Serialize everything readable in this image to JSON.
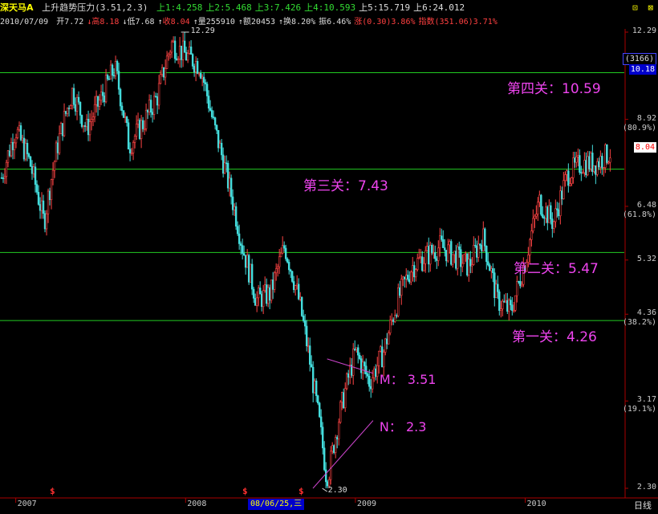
{
  "header": {
    "stock_name": "深天马A",
    "indicator": "上升趋势压力(3.51,2.3)",
    "levels": [
      {
        "label": "上1:",
        "value": "4.258",
        "color": "green"
      },
      {
        "label": "上2:",
        "value": "5.468",
        "color": "green"
      },
      {
        "label": "上3:",
        "value": "7.426",
        "color": "green"
      },
      {
        "label": "上4:",
        "value": "10.593",
        "color": "green"
      },
      {
        "label": "上5:",
        "value": "15.719",
        "color": "white"
      },
      {
        "label": "上6:",
        "value": "24.012",
        "color": "white"
      }
    ],
    "window_buttons": [
      "⊡",
      "⊠"
    ]
  },
  "quote": {
    "date": "2010/07/09",
    "open_label": "开",
    "open": "7.72",
    "high_label": "高",
    "high": "8.18",
    "low_label": "低",
    "low": "7.68",
    "close_label": "收",
    "close": "8.04",
    "volume_label": "量",
    "volume": "255910",
    "amount_label": "额",
    "amount": "20453",
    "turnover_label": "换",
    "turnover": "8.20%",
    "amplitude_label": "振",
    "amplitude": "6.46%",
    "change_label": "涨",
    "change": "(0.30)3.86%",
    "index_label": "指数",
    "index": "(351.06)3.71%"
  },
  "axis": {
    "y_ticks": [
      {
        "value": 12.29,
        "text": "12.29"
      },
      {
        "value": 8.92,
        "text": "8.92"
      },
      {
        "value": 6.48,
        "text": "6.48"
      },
      {
        "value": 5.32,
        "text": "5.32"
      },
      {
        "value": 4.36,
        "text": "4.36"
      },
      {
        "value": 3.17,
        "text": "3.17"
      },
      {
        "value": 2.3,
        "text": "2.30"
      }
    ],
    "y_pcts": [
      {
        "value": 8.92,
        "text": "(80.9%)"
      },
      {
        "value": 6.48,
        "text": "(61.8%)"
      },
      {
        "value": 4.36,
        "text": "(38.2%)"
      },
      {
        "value": 3.17,
        "text": "(19.1%)"
      }
    ],
    "marker_top": {
      "value": 10.6,
      "text1": "(3166)",
      "text2": "10.18"
    },
    "marker_current": {
      "value": 8.04,
      "text": "8.04"
    },
    "date_labels": [
      {
        "text": "2007",
        "x_date": "2007-01"
      },
      {
        "text": "2008",
        "x_date": "2008-01"
      },
      {
        "text": "2009",
        "x_date": "2009-01"
      },
      {
        "text": "2010",
        "x_date": "2010-01"
      }
    ],
    "date_cursor": "08/06/25,三",
    "period": "日线"
  },
  "levels_drawn": [
    {
      "label": "第四关：10.59",
      "value": 10.59
    },
    {
      "label": "第三关：7.43",
      "value": 7.43
    },
    {
      "label": "第二关：5.47",
      "value": 5.47
    },
    {
      "label": "第一关：4.26",
      "value": 4.26
    }
  ],
  "trendlines": [
    {
      "label": "M： 3.51",
      "name": "M",
      "from": {
        "date": "2008-11",
        "price": 3.7
      },
      "to": {
        "date": "2009-01",
        "price": 3.51
      }
    },
    {
      "label": "N： 2.3",
      "name": "N",
      "from": {
        "date": "2008-10",
        "price": 2.3
      },
      "to": {
        "date": "2009-01",
        "price": 2.95
      }
    }
  ],
  "annotations": {
    "high_text": "12.29",
    "low_text": "2.30"
  },
  "signal_markers": [
    "$",
    "$",
    "$"
  ],
  "chart_data": {
    "type": "candlestick",
    "title": "",
    "ylim": [
      2.3,
      12.29
    ],
    "y_log": true,
    "series": [
      {
        "name": "",
        "x": [
          "2006-12",
          "2007-01",
          "2007-02",
          "2007-03",
          "2007-04",
          "2007-05",
          "2007-06",
          "2007-07",
          "2007-08",
          "2007-09",
          "2007-10",
          "2007-11",
          "2007-12",
          "2008-01",
          "2008-02",
          "2008-03",
          "2008-04",
          "2008-05",
          "2008-06",
          "2008-07",
          "2008-08",
          "2008-09",
          "2008-10",
          "2008-11",
          "2008-12",
          "2009-01",
          "2009-02",
          "2009-03",
          "2009-04",
          "2009-05",
          "2009-06",
          "2009-07",
          "2009-08",
          "2009-09",
          "2009-10",
          "2009-11",
          "2009-12",
          "2010-01",
          "2010-02",
          "2010-03",
          "2010-04",
          "2010-05",
          "2010-06",
          "2010-07"
        ],
        "y": [
          7.2,
          8.6,
          7.6,
          6.1,
          8.2,
          9.9,
          8.6,
          9.6,
          10.8,
          8.1,
          8.8,
          9.7,
          11.8,
          11.3,
          10.9,
          8.7,
          7.1,
          5.6,
          4.6,
          4.7,
          5.6,
          4.6,
          3.4,
          2.35,
          3.1,
          3.8,
          3.4,
          3.8,
          4.6,
          5.2,
          5.4,
          5.6,
          5.4,
          5.2,
          5.8,
          4.6,
          4.4,
          5.3,
          6.6,
          6.1,
          7.3,
          7.6,
          7.6,
          7.9
        ]
      }
    ],
    "current_close": 8.04
  }
}
